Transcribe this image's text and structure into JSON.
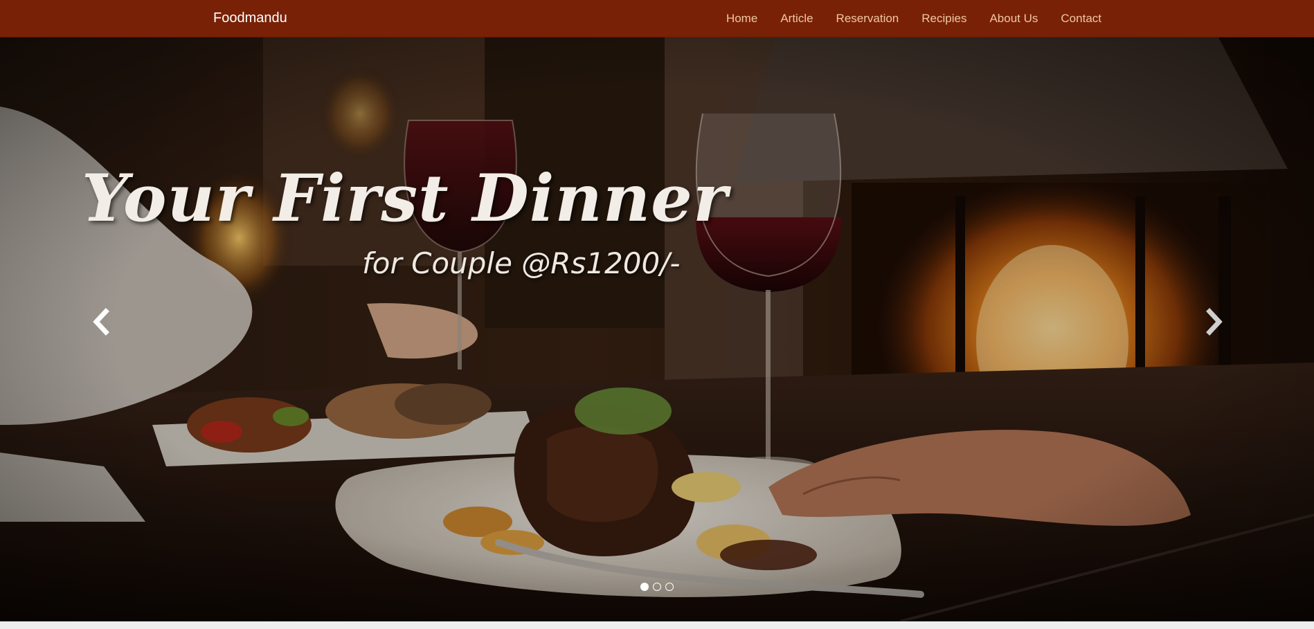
{
  "navbar": {
    "brand": "Foodmandu",
    "links": [
      "Home",
      "Article",
      "Reservation",
      "Recipies",
      "About Us",
      "Contact"
    ],
    "colors": {
      "background": "#782106",
      "link": "#f1c7a4",
      "brand": "#ffffff"
    }
  },
  "carousel": {
    "headline": "Your First Dinner",
    "subline": "for Couple @Rs1200/-",
    "prev_icon": "chevron-left-icon",
    "next_icon": "chevron-right-icon",
    "slide_count": 3,
    "active_slide": 1
  }
}
